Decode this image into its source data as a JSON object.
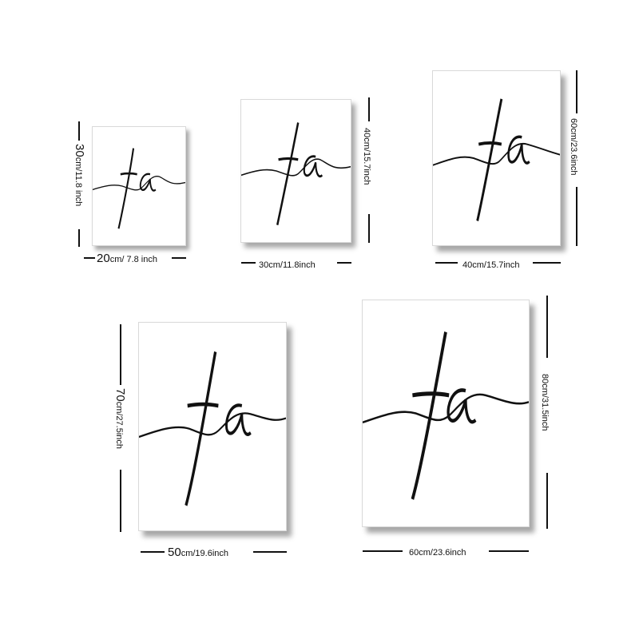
{
  "prints": [
    {
      "size_cm": "20",
      "width_label": {
        "big": "20",
        "small": "cm/ 7.8 inch"
      },
      "height_label": {
        "big": "30",
        "small": "cm/11.8 inch"
      }
    },
    {
      "size_cm": "30",
      "width_label": {
        "big": "",
        "small": "30cm/11.8inch"
      },
      "height_label": {
        "big": "",
        "small": "40cm/15.7inch"
      }
    },
    {
      "size_cm": "40",
      "width_label": {
        "big": "",
        "small": "40cm/15.7inch"
      },
      "height_label": {
        "big": "",
        "small": "60cm/23.6inch"
      }
    },
    {
      "size_cm": "50",
      "width_label": {
        "big": "50",
        "small": "cm/19.6inch"
      },
      "height_label": {
        "big": "70",
        "small": "cm/27.5inch"
      }
    },
    {
      "size_cm": "60",
      "width_label": {
        "big": "",
        "small": "60cm/23.6inch"
      },
      "height_label": {
        "big": "",
        "small": "80cm/31.5inch"
      }
    }
  ],
  "artwork_text": "fa",
  "colors": {
    "ink": "#111111",
    "frame_border": "#d9d9d9",
    "background": "#ffffff"
  }
}
